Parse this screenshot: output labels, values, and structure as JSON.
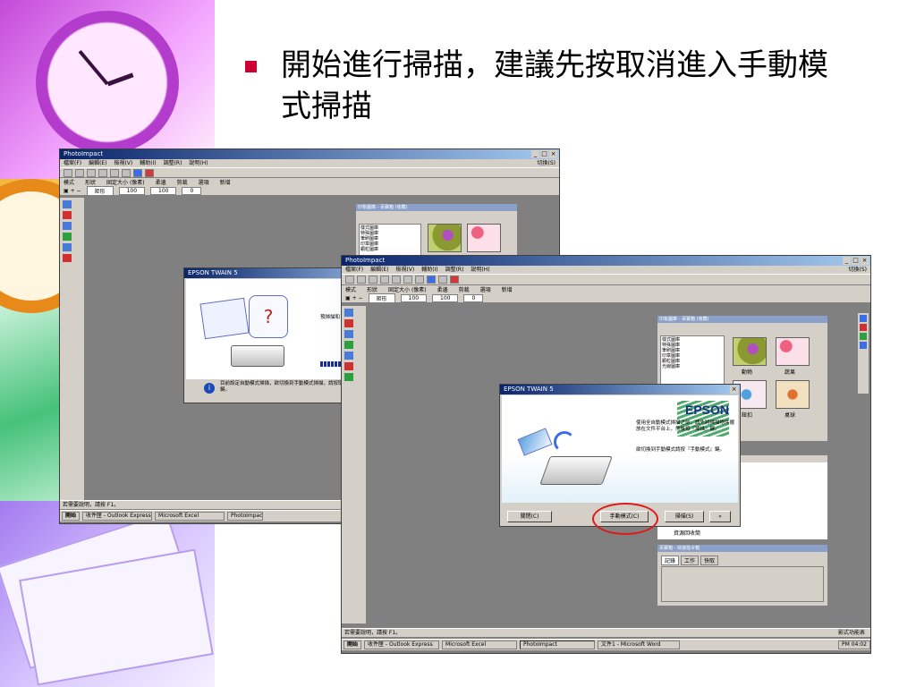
{
  "slide": {
    "title": "開始進行掃描，建議先按取消進入手動模式掃描",
    "accent": "#cc0033",
    "highlight_color": "#e01818"
  },
  "back_window": {
    "title": "PhotoImpact",
    "menu": [
      "檔案(F)",
      "編輯(E)",
      "檢視(V)",
      "輔助(I)",
      "調整(R)",
      "說明(H)"
    ],
    "menu_right": "切換(S)",
    "options": [
      "模式",
      "形狀",
      "固定大小 (像素)",
      "柔邊",
      "剪裁",
      "選項",
      "新增"
    ],
    "shape_value": "矩形",
    "width_value": "100",
    "height_value": "100",
    "soft_value": "0",
    "dialog_title": "EPSON TWAIN 5",
    "dialog_prescan": "預掃描和",
    "dialog_info": "目前設定自動模式掃描，欲切換到手動模式掃描，請按取消鍵。",
    "panel_title": "印象圖庫 - 百寶箱 (收藏)",
    "tree": [
      "樣式圖庫",
      "特殊圖庫",
      "筆刷圖庫",
      "印章圖庫",
      "顆粒圖庫"
    ],
    "status": "若需要說明，請按 F1。",
    "taskbar": [
      "開始",
      "收件匣 - Outlook Express",
      "Microsoft Excel",
      "PhotoImpact"
    ]
  },
  "front_window": {
    "title": "PhotoImpact",
    "menu": [
      "檔案(F)",
      "編輯(E)",
      "檢視(V)",
      "輔助(I)",
      "調整(R)",
      "說明(H)"
    ],
    "menu_right": "切換(S)",
    "options": [
      "模式",
      "形狀",
      "固定大小 (像素)",
      "柔邊",
      "剪裁",
      "選項",
      "新增"
    ],
    "shape_value": "矩形",
    "width_value": "100",
    "height_value": "100",
    "soft_value": "0",
    "panel_title": "印象圖庫 - 百寶箱 (收藏)",
    "tree": [
      "樣式圖庫",
      "特殊圖庫",
      "筆刷圖庫",
      "印章圖庫",
      "顆粒圖庫",
      "光線圖庫"
    ],
    "thumb_labels": [
      "動物",
      "蔬果",
      "鈕扣",
      "桌球"
    ],
    "recycle": "資源回收筒",
    "quick_panel_title": "百寶箱 - 快速指令箱",
    "quick_tabs": [
      "記錄",
      "工作",
      "快取"
    ],
    "status": "若需要說明，請按 F1。",
    "status_right": "影式功能表",
    "taskbar": [
      "開始",
      "收件匣 - Outlook Express",
      "Microsoft Excel",
      "PhotoImpact",
      "文件1 - Microsoft Word"
    ],
    "clock": "PM 04:02"
  },
  "epson_dialog": {
    "title": "EPSON TWAIN 5",
    "brand": "EPSON",
    "text1": "使用全自動模式掃描之前，請先將掃描物件擺放在文件平台上，然後按『掃描』鍵。",
    "text2": "欲切換到手動模式請按『手動模式』鍵。",
    "btn_close": "關閉(C)",
    "btn_manual": "手動模式(C)",
    "btn_scan": "掃描(S)",
    "btn_more": "»"
  }
}
